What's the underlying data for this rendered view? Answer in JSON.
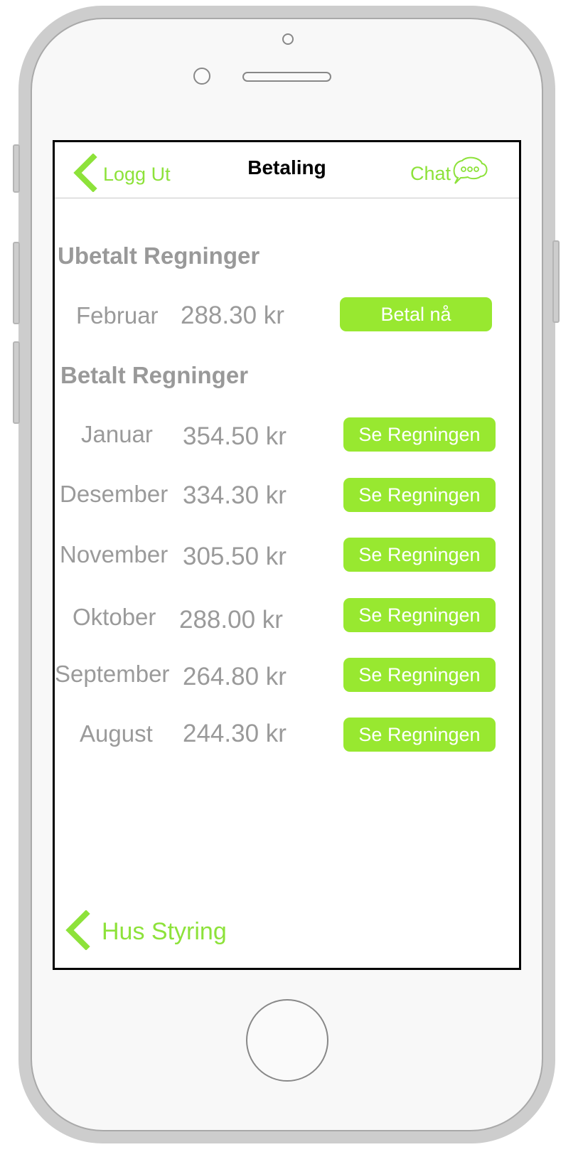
{
  "nav": {
    "back_label": "Logg Ut",
    "title": "Betaling",
    "chat_label": "Chat"
  },
  "unpaid": {
    "heading": "Ubetalt Regninger",
    "rows": [
      {
        "month": "Februar",
        "amount": "288.30 kr",
        "button": "Betal nå"
      }
    ]
  },
  "paid": {
    "heading": "Betalt Regninger",
    "rows": [
      {
        "month": "Januar",
        "amount": "354.50 kr",
        "button": "Se Regningen"
      },
      {
        "month": "Desember",
        "amount": "334.30 kr",
        "button": "Se Regningen"
      },
      {
        "month": "November",
        "amount": "305.50 kr",
        "button": "Se Regningen"
      },
      {
        "month": "Oktober",
        "amount": "288.00 kr",
        "button": "Se Regningen"
      },
      {
        "month": "September",
        "amount": "264.80 kr",
        "button": "Se Regningen"
      },
      {
        "month": "August",
        "amount": "244.30 kr",
        "button": "Se Regningen"
      }
    ]
  },
  "footer": {
    "back_label": "Hus Styring"
  },
  "colors": {
    "accent": "#8de23a",
    "button": "#98e830",
    "text_gray": "#9a9a9a"
  },
  "icons": {
    "back": "chevron-left-icon",
    "chat": "chat-bubble-icon"
  }
}
